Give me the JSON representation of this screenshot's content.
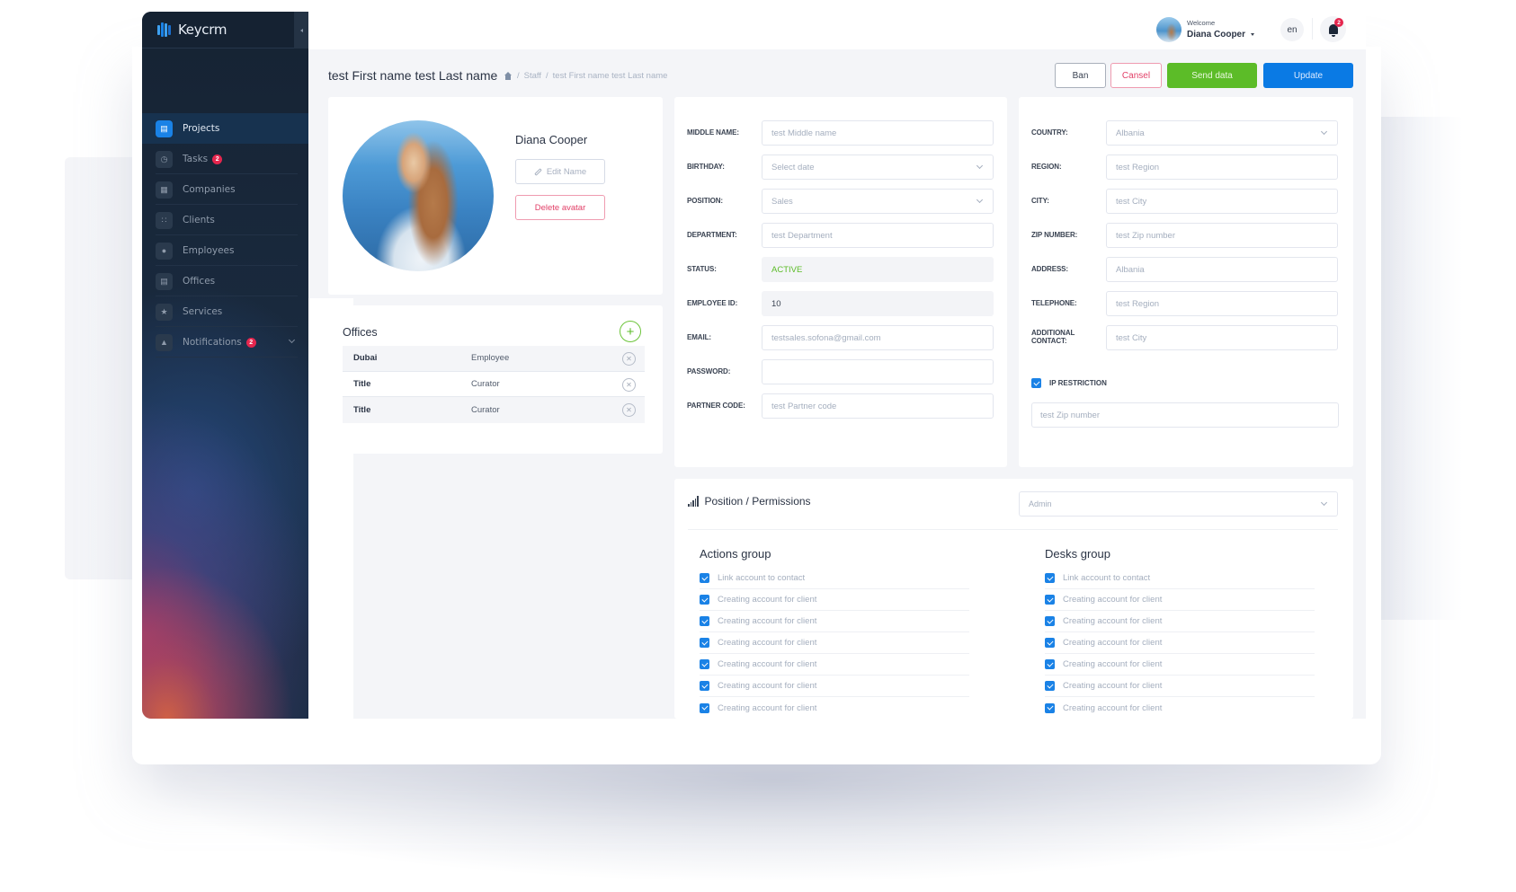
{
  "app": {
    "name": "Keycrm",
    "brand_color": "#1a82e6"
  },
  "header": {
    "welcome": "Welcome",
    "user_name": "Diana Cooper",
    "language": "en",
    "notifications_count": "2"
  },
  "sidebar": {
    "items": [
      {
        "label": "Projects",
        "icon": "briefcase-icon",
        "active": true
      },
      {
        "label": "Tasks",
        "icon": "stopwatch-icon",
        "badge": "2"
      },
      {
        "label": "Companies",
        "icon": "building-icon"
      },
      {
        "label": "Clients",
        "icon": "users-icon"
      },
      {
        "label": "Employees",
        "icon": "user-icon"
      },
      {
        "label": "Offices",
        "icon": "bank-icon"
      },
      {
        "label": "Services",
        "icon": "star-icon"
      },
      {
        "label": "Notifications",
        "icon": "bell-icon",
        "badge": "2",
        "expandable": true
      }
    ]
  },
  "page": {
    "title": "test First name test Last name",
    "breadcrumb": [
      "Staff",
      "test First name test Last name"
    ],
    "actions": {
      "ban": "Ban",
      "cancel": "Cansel",
      "send": "Send data",
      "update": "Update"
    }
  },
  "profile": {
    "name": "Diana Cooper",
    "edit_name": "Edit Name",
    "delete_avatar": "Delete avatar"
  },
  "offices": {
    "title": "Offices",
    "rows": [
      {
        "name": "Dubai",
        "role": "Employee"
      },
      {
        "name": "Title",
        "role": "Curator"
      },
      {
        "name": "Title",
        "role": "Curator"
      }
    ]
  },
  "form_left": {
    "fields": [
      {
        "label": "MIDDLE NAME:",
        "value": "test Middle name"
      },
      {
        "label": "BIRTHDAY:",
        "value": "Select date",
        "type": "select"
      },
      {
        "label": "POSITION:",
        "value": "Sales",
        "type": "select"
      },
      {
        "label": "DEPARTMENT:",
        "value": "test Department"
      },
      {
        "label": "STATUS:",
        "value": "ACTIVE",
        "type": "readonly"
      },
      {
        "label": "EMPLOYEE ID:",
        "value": "10",
        "type": "readonly"
      },
      {
        "label": "EMAIL:",
        "value": "testsales.sofona@gmail.com"
      },
      {
        "label": "PASSWORD:",
        "value": ""
      },
      {
        "label": "PARTNER CODE:",
        "value": "test Partner code"
      }
    ]
  },
  "form_right": {
    "fields": [
      {
        "label": "COUNTRY:",
        "value": "Albania",
        "type": "select"
      },
      {
        "label": "REGION:",
        "value": "test Region"
      },
      {
        "label": "CITY:",
        "value": "test City"
      },
      {
        "label": "ZIP NUMBER:",
        "value": "test Zip number"
      },
      {
        "label": "ADDRESS:",
        "value": "Albania"
      },
      {
        "label": "TELEPHONE:",
        "value": "test Region"
      },
      {
        "label": "ADDITIONAL CONTACT:",
        "value": "test City"
      }
    ],
    "ip_restriction": {
      "label": "IP RESTRICTION",
      "checked": true,
      "value": "test Zip number"
    }
  },
  "permissions": {
    "title": "Position / Permissions",
    "role": "Admin",
    "groups": [
      {
        "title": "Actions group",
        "items": [
          "Link account to contact",
          "Creating account for client",
          "Creating account for client",
          "Creating account for client",
          "Creating account for client",
          "Creating account for client",
          "Creating account for client"
        ]
      },
      {
        "title": "Desks group",
        "items": [
          "Link account to contact",
          "Creating account for client",
          "Creating account for client",
          "Creating account for client",
          "Creating account for client",
          "Creating account for client",
          "Creating account for client"
        ]
      }
    ]
  }
}
